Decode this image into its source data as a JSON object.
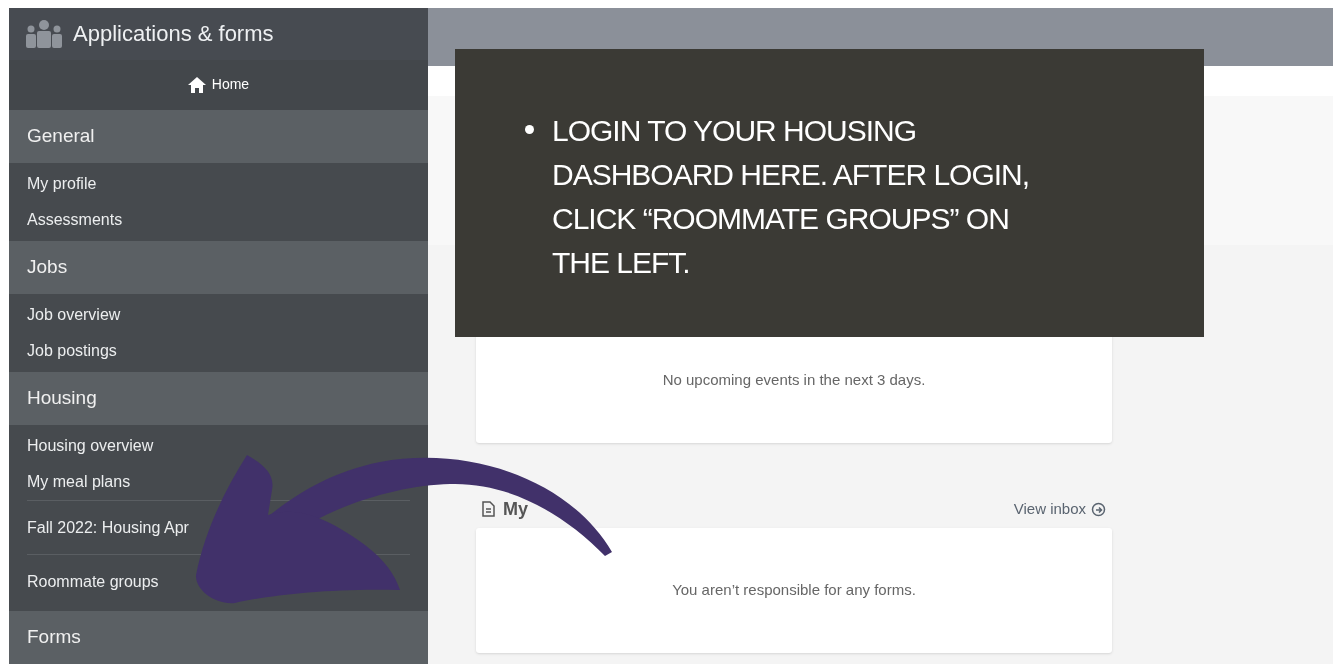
{
  "sidebar": {
    "title": "Applications & forms",
    "home": "Home",
    "sections": [
      {
        "title": "General",
        "items": [
          {
            "label": "My profile",
            "kind": "plain"
          },
          {
            "label": "Assessments",
            "kind": "plain"
          }
        ]
      },
      {
        "title": "Jobs",
        "items": [
          {
            "label": "Job overview",
            "kind": "plain"
          },
          {
            "label": "Job postings",
            "kind": "plain"
          }
        ]
      },
      {
        "title": "Housing",
        "items": [
          {
            "label": "Housing overview",
            "kind": "plain"
          },
          {
            "label": "My meal plans",
            "kind": "plain"
          },
          {
            "label": "Fall 2022: Housing Apr",
            "kind": "separated"
          },
          {
            "label": "Roommate groups",
            "kind": "separated"
          }
        ]
      },
      {
        "title": "Forms"
      }
    ]
  },
  "main": {
    "upcoming": {
      "message": "No upcoming events in the next 3 days."
    },
    "forms": {
      "title": "My",
      "link": "View inbox",
      "message": "You aren’t responsible for any forms."
    }
  },
  "callout": {
    "bullets": [
      "LOGIN TO YOUR HOUSING DASHBOARD HERE. AFTER LOGIN, CLICK “ROOMMATE GROUPS” ON THE LEFT."
    ]
  }
}
